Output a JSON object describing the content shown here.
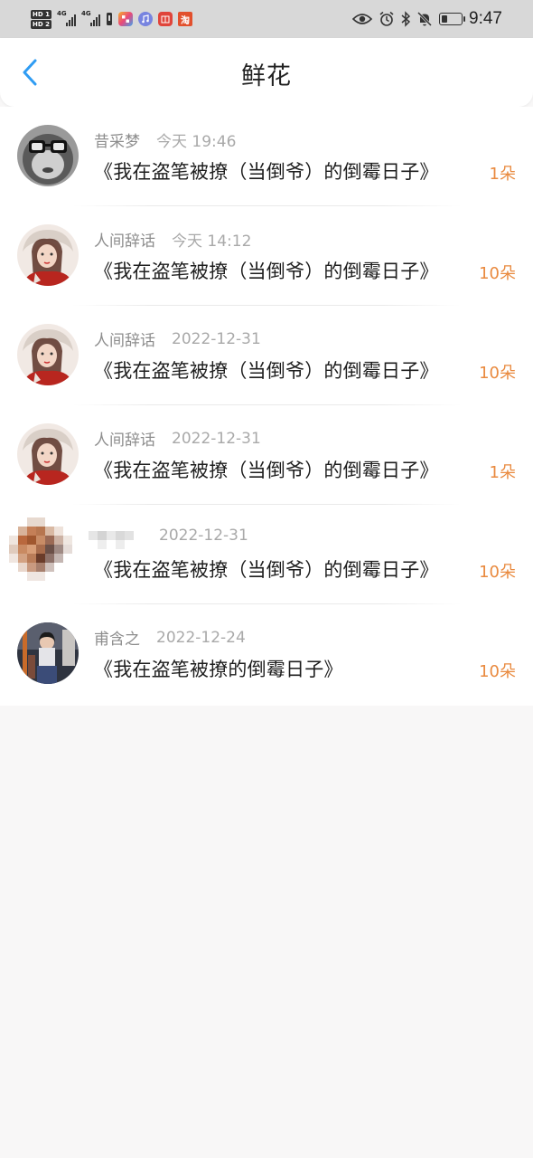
{
  "status_bar": {
    "network_a": "4G",
    "network_b": "4G",
    "time": "9:47",
    "apps": [
      {
        "name": "app-icon-colorful",
        "color": "#f5b02a"
      },
      {
        "name": "music-icon",
        "color": "#6c7bd9"
      },
      {
        "name": "book-icon",
        "color": "#e0443a"
      },
      {
        "name": "taobao-icon",
        "color": "#e2502d",
        "label": "淘"
      }
    ]
  },
  "header": {
    "title": "鲜花",
    "accent": "#2f9cf3"
  },
  "list": {
    "items": [
      {
        "user": "昔采梦",
        "time": "今天 19:46",
        "title": "《我在盗笔被撩（当倒爷）的倒霉日子》",
        "count": "1朵",
        "avatar": "avatar-monkey"
      },
      {
        "user": "人间辞话",
        "time": "今天 14:12",
        "title": "《我在盗笔被撩（当倒爷）的倒霉日子》",
        "count": "10朵",
        "avatar": "avatar-girl"
      },
      {
        "user": "人间辞话",
        "time": "2022-12-31",
        "title": "《我在盗笔被撩（当倒爷）的倒霉日子》",
        "count": "10朵",
        "avatar": "avatar-girl"
      },
      {
        "user": "人间辞话",
        "time": "2022-12-31",
        "title": "《我在盗笔被撩（当倒爷）的倒霉日子》",
        "count": "1朵",
        "avatar": "avatar-girl"
      },
      {
        "user": "",
        "time": "2022-12-31",
        "title": "《我在盗笔被撩（当倒爷）的倒霉日子》",
        "count": "10朵",
        "avatar": "avatar-pixelated"
      },
      {
        "user": "甫含之",
        "time": "2022-12-24",
        "title": "《我在盗笔被撩的倒霉日子》",
        "count": "10朵",
        "avatar": "avatar-photo"
      }
    ]
  },
  "colors": {
    "count": "#e98a3f",
    "meta": "#8d8d8d",
    "title": "#1e1e1e"
  }
}
